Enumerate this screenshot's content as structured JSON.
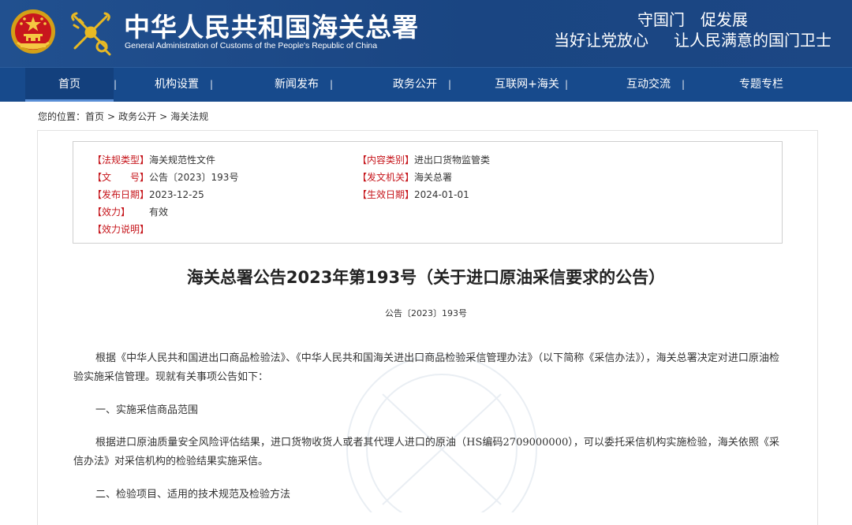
{
  "header": {
    "title": "中华人民共和国海关总署",
    "subtitle": "General Administration of Customs of the People's Republic of China",
    "slogan_line1": "守国门　促发展",
    "slogan_line2_a": "当好让党放心",
    "slogan_line2_b": "让人民满意的国门卫士"
  },
  "nav": {
    "items": [
      {
        "label": "首页"
      },
      {
        "label": "机构设置"
      },
      {
        "label": "新闻发布"
      },
      {
        "label": "政务公开"
      },
      {
        "label": "互联网+海关"
      },
      {
        "label": "互动交流"
      },
      {
        "label": "专题专栏"
      }
    ],
    "separator": "|"
  },
  "breadcrumb": {
    "prefix": "您的位置：",
    "items": [
      "首页",
      "政务公开",
      "海关法规"
    ],
    "separator": ">"
  },
  "meta": {
    "law_type_label": "【法规类型】",
    "law_type": "海关规范性文件",
    "category_label": "【内容类别】",
    "category": "进出口货物监管类",
    "doc_no_label": "【文　　号】",
    "doc_no": "公告〔2023〕193号",
    "issuer_label": "【发文机关】",
    "issuer": "海关总署",
    "publish_date_label": "【发布日期】",
    "publish_date": "2023-12-25",
    "effective_date_label": "【生效日期】",
    "effective_date": "2024-01-01",
    "validity_label": "【效力】",
    "validity": "有效",
    "validity_note_label": "【效力说明】",
    "validity_note": ""
  },
  "article": {
    "title": "海关总署公告2023年第193号（关于进口原油采信要求的公告）",
    "number": "公告〔2023〕193号",
    "paragraphs": [
      "根据《中华人民共和国进出口商品检验法》、《中华人民共和国海关进出口商品检验采信管理办法》（以下简称《采信办法》），海关总署决定对进口原油检验实施采信管理。现就有关事项公告如下：",
      "一、实施采信商品范围",
      "根据进口原油质量安全风险评估结果，进口货物收货人或者其代理人进口的原油（HS编码2709000000），可以委托采信机构实施检验，海关依照《采信办法》对采信机构的检验结果实施采信。",
      "二、检验项目、适用的技术规范及检验方法"
    ]
  },
  "colors": {
    "header_bg": "#1d4a86",
    "nav_bg": "#174a8c",
    "label_red": "#c6151b"
  }
}
